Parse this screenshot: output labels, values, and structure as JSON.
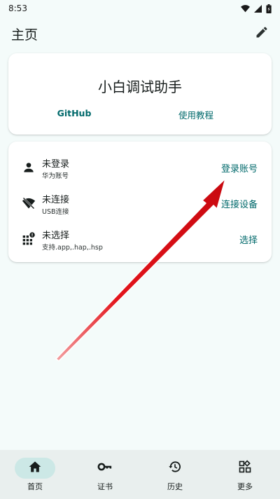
{
  "status_bar": {
    "time": "8:53",
    "icons": [
      "wifi-icon",
      "signal-icon",
      "battery-icon"
    ]
  },
  "app_bar": {
    "title": "主页",
    "edit_icon": "pencil-icon"
  },
  "top_card": {
    "title": "小白调试助手",
    "links": {
      "github": "GitHub",
      "tutorial": "使用教程"
    }
  },
  "list_card": {
    "rows": [
      {
        "icon": "person-icon",
        "title": "未登录",
        "subtitle": "华为账号",
        "action": "登录账号"
      },
      {
        "icon": "wifi-off-icon",
        "title": "未连接",
        "subtitle": "USB连接",
        "action": "连接设备"
      },
      {
        "icon": "apps-alert-icon",
        "title": "未选择",
        "subtitle": "支持.app,.hap,.hsp",
        "action": "选择"
      }
    ]
  },
  "bottom_nav": {
    "items": [
      {
        "icon": "home-icon",
        "label": "首页",
        "active": true
      },
      {
        "icon": "key-icon",
        "label": "证书",
        "active": false
      },
      {
        "icon": "history-icon",
        "label": "历史",
        "active": false
      },
      {
        "icon": "grid-more-icon",
        "label": "更多",
        "active": false
      }
    ]
  },
  "colors": {
    "accent": "#00696b",
    "background": "#f4fbfa",
    "nav_background": "#e9efee",
    "nav_active_pill": "#cce8e6",
    "annotation_arrow": "#e3141b"
  }
}
